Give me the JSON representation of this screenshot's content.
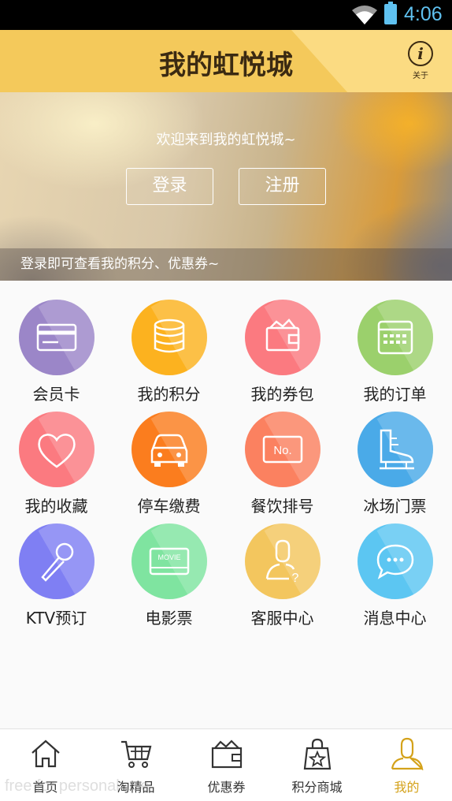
{
  "status_bar": {
    "time": "4:06",
    "battery_color": "#5fc1f0"
  },
  "header": {
    "title": "我的虹悦城",
    "about_label": "关于",
    "bg": "#f4c95b"
  },
  "banner": {
    "welcome": "欢迎来到我的虹悦城~",
    "login_label": "登录",
    "register_label": "注册",
    "hint": "登录即可查看我的积分、优惠券~"
  },
  "grid": {
    "items": [
      {
        "label": "会员卡",
        "icon": "card-icon",
        "color": "#9b86c8"
      },
      {
        "label": "我的积分",
        "icon": "coins-icon",
        "color": "#fcb21f"
      },
      {
        "label": "我的券包",
        "icon": "wallet-icon",
        "color": "#fb7a80"
      },
      {
        "label": "我的订单",
        "icon": "calendar-icon",
        "color": "#9bd06c"
      },
      {
        "label": "我的收藏",
        "icon": "heart-icon",
        "color": "#fb7a80"
      },
      {
        "label": "停车缴费",
        "icon": "car-icon",
        "color": "#fb7d1e"
      },
      {
        "label": "餐饮排号",
        "icon": "queue-number-icon",
        "color": "#fb8160"
      },
      {
        "label": "冰场门票",
        "icon": "skate-icon",
        "color": "#4aaae8"
      },
      {
        "label": "KTV预订",
        "icon": "microphone-icon",
        "color": "#7f7ff3"
      },
      {
        "label": "电影票",
        "icon": "movie-ticket-icon",
        "color": "#7fe4a0"
      },
      {
        "label": "客服中心",
        "icon": "customer-service-icon",
        "color": "#f3c65e"
      },
      {
        "label": "消息中心",
        "icon": "chat-bubble-icon",
        "color": "#5cc6f2"
      }
    ]
  },
  "tabbar": {
    "tabs": [
      {
        "label": "首页",
        "icon": "home-icon"
      },
      {
        "label": "淘精品",
        "icon": "cart-icon"
      },
      {
        "label": "优惠券",
        "icon": "coupon-icon"
      },
      {
        "label": "积分商城",
        "icon": "shopping-bag-icon"
      },
      {
        "label": "我的",
        "icon": "user-icon",
        "active": true
      }
    ],
    "active_color": "#d4a21a"
  },
  "watermark": "free for personal use"
}
